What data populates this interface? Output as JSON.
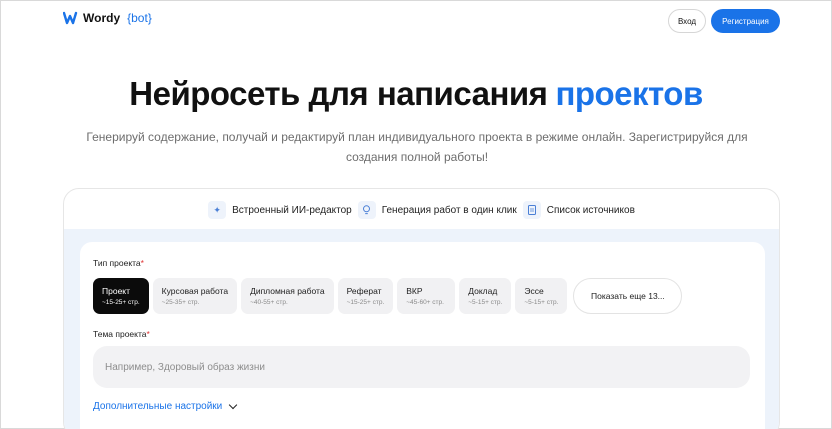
{
  "header": {
    "logo_word": "Wordy",
    "logo_bot": "{bot}",
    "login_label": "Вход",
    "register_label": "Регистрация"
  },
  "hero": {
    "title_main": "Нейросеть для написания",
    "title_accent": "проектов",
    "subtitle": "Генерируй содержание, получай и редактируй план индивидуального проекта в режиме онлайн. Зарегистрируйся для создания полной работы!"
  },
  "features": [
    {
      "icon": "sparkle-icon",
      "label": "Встроенный ИИ-редактор"
    },
    {
      "icon": "lightbulb-icon",
      "label": "Генерация работ в один клик"
    },
    {
      "icon": "document-icon",
      "label": "Список источников"
    }
  ],
  "form": {
    "type_label": "Тип проекта",
    "required_mark": "*",
    "types": [
      {
        "name": "Проект",
        "pages": "~15-25+ стр.",
        "active": true
      },
      {
        "name": "Курсовая работа",
        "pages": "~25-35+ стр."
      },
      {
        "name": "Дипломная работа",
        "pages": "~40-55+ стр."
      },
      {
        "name": "Реферат",
        "pages": "~15-25+ стр."
      },
      {
        "name": "ВКР",
        "pages": "~45-60+ стр."
      },
      {
        "name": "Доклад",
        "pages": "~5-15+ стр."
      },
      {
        "name": "Эссе",
        "pages": "~5-15+ стр."
      }
    ],
    "more_types_label": "Показать еще 13...",
    "topic_label": "Тема проекта",
    "topic_placeholder": "Например, Здоровый образ жизни",
    "topic_value": "",
    "more_settings_label": "Дополнительные настройки"
  },
  "colors": {
    "accent": "#1a73e8",
    "active_chip": "#0b0b0b",
    "panel_bg": "#edf3fb"
  }
}
